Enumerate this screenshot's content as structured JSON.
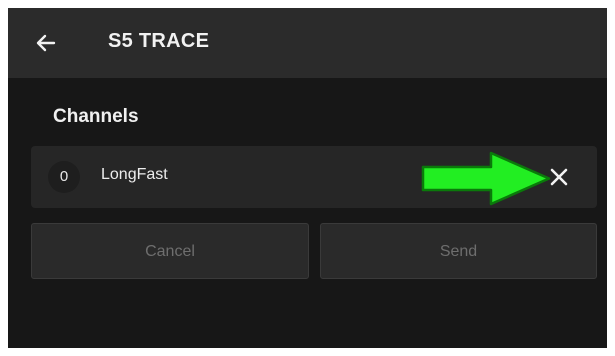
{
  "app_bar": {
    "title": "S5 TRACE",
    "back_icon": "arrow-left-icon"
  },
  "section": {
    "title": "Channels"
  },
  "channels": [
    {
      "index": "0",
      "name": "LongFast",
      "remove_icon": "close-icon"
    }
  ],
  "annotation": {
    "icon": "arrow-right-icon",
    "color": "#22ee22"
  },
  "actions": {
    "cancel_label": "Cancel",
    "send_label": "Send"
  },
  "colors": {
    "background": "#171717",
    "app_bar": "#2b2b2b",
    "row": "#262626",
    "button": "#2a2a2a",
    "disabled_text": "#6e6e6e"
  }
}
